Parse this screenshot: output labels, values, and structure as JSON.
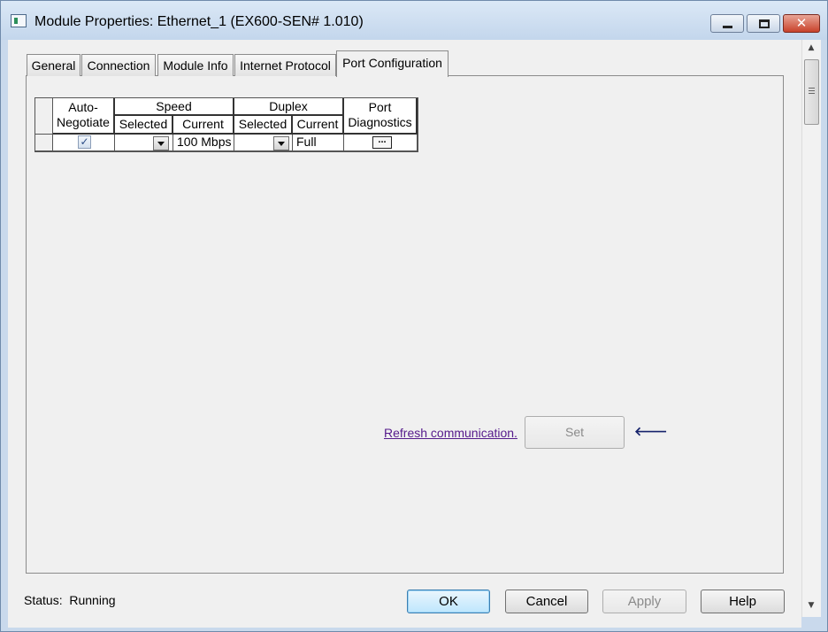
{
  "window": {
    "title": "Module Properties: Ethernet_1 (EX600-SEN# 1.010)"
  },
  "tabs": [
    {
      "label": "General",
      "active": false
    },
    {
      "label": "Connection",
      "active": false
    },
    {
      "label": "Module Info",
      "active": false
    },
    {
      "label": "Internet Protocol",
      "active": false
    },
    {
      "label": "Port Configuration",
      "active": true
    }
  ],
  "port_table": {
    "headers": {
      "auto_negotiate": "Auto-\nNegotiate",
      "speed": "Speed",
      "duplex": "Duplex",
      "port_diagnostics": "Port\nDiagnostics",
      "selected": "Selected",
      "current": "Current"
    },
    "rows": [
      {
        "auto_negotiate": true,
        "speed_selected": "",
        "speed_current": "100 Mbps",
        "duplex_selected": "",
        "duplex_current": "Full",
        "diagnostics_button": "..."
      }
    ]
  },
  "refresh_link": "Refresh communication.",
  "set_button": "Set",
  "status": {
    "label": "Status:",
    "value": "Running"
  },
  "buttons": {
    "ok": "OK",
    "cancel": "Cancel",
    "apply": "Apply",
    "help": "Help"
  },
  "caption_buttons": {
    "close": "✕"
  }
}
